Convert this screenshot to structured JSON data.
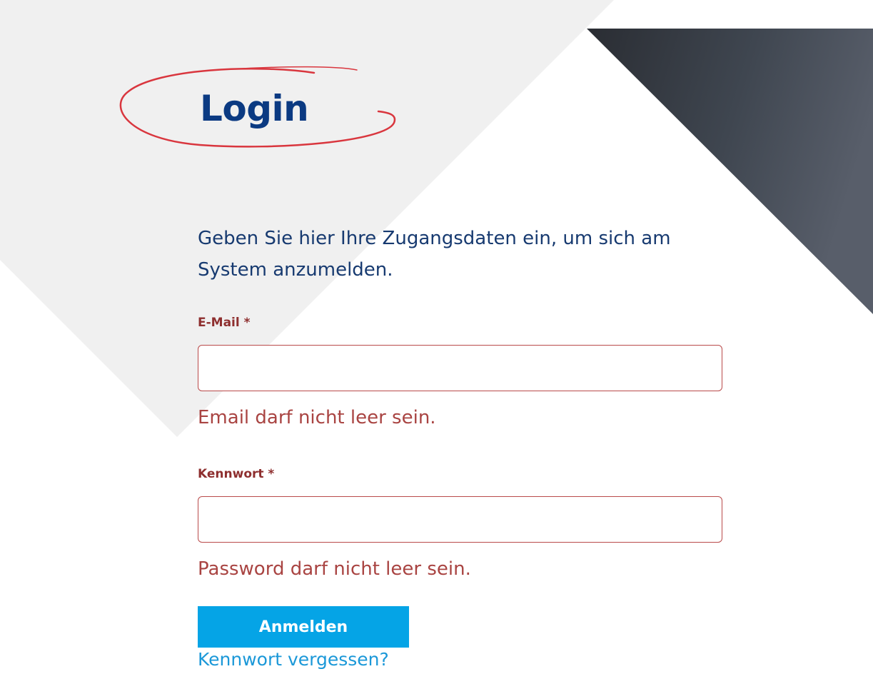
{
  "page": {
    "title": "Login",
    "intro": "Geben Sie hier Ihre Zugangsdaten ein, um sich am System anzumelden."
  },
  "form": {
    "email": {
      "label": "E-Mail *",
      "value": "",
      "error": "Email darf nicht leer sein."
    },
    "password": {
      "label": "Kennwort *",
      "value": "",
      "error": "Password darf nicht leer sein."
    },
    "submit_label": "Anmelden",
    "forgot_label": "Kennwort vergessen?"
  },
  "colors": {
    "title": "#0b3a82",
    "title_circle": "#d9363e",
    "error": "#a94442",
    "input_border": "#b94a4a",
    "button": "#05a4e6",
    "link": "#1b98d8",
    "gray_panel": "#f0f0f0"
  }
}
